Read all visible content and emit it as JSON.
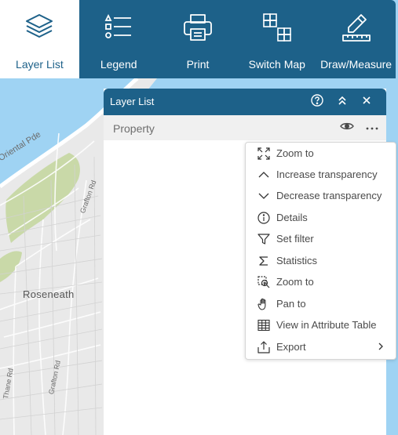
{
  "toolbar": {
    "tools": [
      {
        "label": "Layer List",
        "icon": "layers-icon",
        "active": true
      },
      {
        "label": "Legend",
        "icon": "legend-icon",
        "active": false
      },
      {
        "label": "Print",
        "icon": "printer-icon",
        "active": false
      },
      {
        "label": "Switch Map",
        "icon": "switch-map-icon",
        "active": false
      },
      {
        "label": "Draw/Measure",
        "icon": "pencil-ruler-icon",
        "active": false
      }
    ]
  },
  "map": {
    "labels": {
      "oriental": "Oriental Pde",
      "grafton1": "Grafton Rd",
      "grafton2": "Grafton Rd",
      "thane": "Thane Rd",
      "roseneath": "Roseneath"
    }
  },
  "panel": {
    "title": "Layer List",
    "layer": {
      "name": "Property"
    }
  },
  "menu": {
    "items": [
      {
        "label": "Zoom to",
        "icon": "zoom-extent-icon"
      },
      {
        "label": "Increase transparency",
        "icon": "chevron-up-icon"
      },
      {
        "label": "Decrease transparency",
        "icon": "chevron-down-icon"
      },
      {
        "label": "Details",
        "icon": "info-icon"
      },
      {
        "label": "Set filter",
        "icon": "filter-icon"
      },
      {
        "label": "Statistics",
        "icon": "sigma-icon"
      },
      {
        "label": "Zoom to",
        "icon": "zoom-selection-icon"
      },
      {
        "label": "Pan to",
        "icon": "hand-icon"
      },
      {
        "label": "View in Attribute Table",
        "icon": "table-icon"
      },
      {
        "label": "Export",
        "icon": "export-icon",
        "submenu": true
      }
    ]
  },
  "colors": {
    "header": "#1d6189",
    "water": "#9fd3f3",
    "land": "#e9e9e9",
    "park": "#c9d9a8"
  }
}
